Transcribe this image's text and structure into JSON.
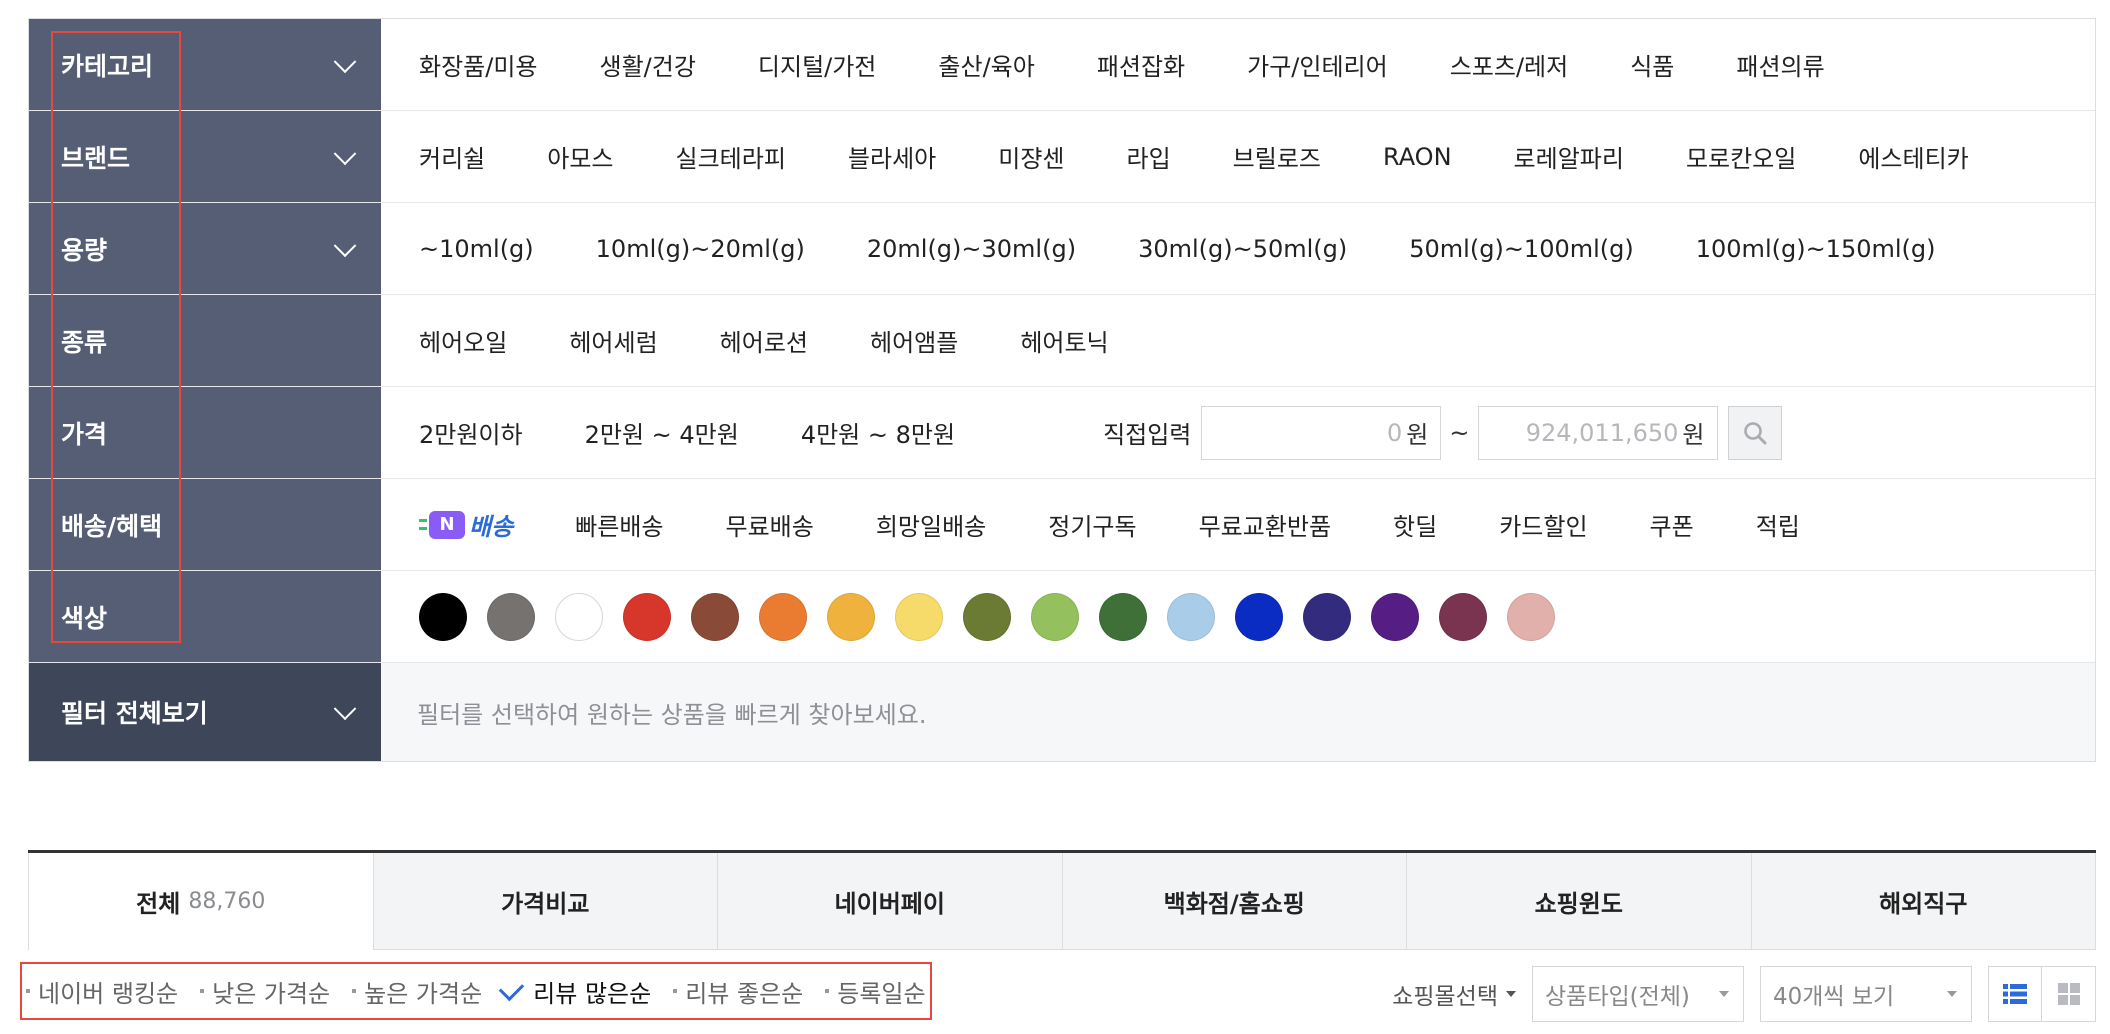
{
  "filter": {
    "rows": [
      {
        "label": "카테고리",
        "expandable": true,
        "options": [
          "화장품/미용",
          "생활/건강",
          "디지털/가전",
          "출산/육아",
          "패션잡화",
          "가구/인테리어",
          "스포츠/레저",
          "식품",
          "패션의류"
        ]
      },
      {
        "label": "브랜드",
        "expandable": true,
        "options": [
          "커리쉴",
          "아모스",
          "실크테라피",
          "블라세아",
          "미쟝센",
          "라입",
          "브릴로즈",
          "RAON",
          "로레알파리",
          "모로칸오일",
          "에스테티카"
        ]
      },
      {
        "label": "용량",
        "expandable": true,
        "options": [
          "~10ml(g)",
          "10ml(g)~20ml(g)",
          "20ml(g)~30ml(g)",
          "30ml(g)~50ml(g)",
          "50ml(g)~100ml(g)",
          "100ml(g)~150ml(g)"
        ]
      },
      {
        "label": "종류",
        "expandable": false,
        "options": [
          "헤어오일",
          "헤어세럼",
          "헤어로션",
          "헤어앰플",
          "헤어토닉"
        ]
      },
      {
        "label": "가격",
        "expandable": false,
        "options": [
          "2만원이하",
          "2만원 ~ 4만원",
          "4만원 ~ 8만원"
        ],
        "direct_input_label": "직접입력",
        "min_placeholder": "0",
        "max_placeholder": "924,011,650",
        "currency": "원",
        "range_sep": "~"
      },
      {
        "label": "배송/혜택",
        "expandable": false,
        "npay_badge": "N",
        "npay_text": "배송",
        "options": [
          "빠른배송",
          "무료배송",
          "희망일배송",
          "정기구독",
          "무료교환반품",
          "핫딜",
          "카드할인",
          "쿠폰",
          "적립"
        ]
      },
      {
        "label": "색상",
        "expandable": false,
        "colors": [
          "#000000",
          "#757270",
          "#ffffff",
          "#d7362b",
          "#8a4a38",
          "#ea7c32",
          "#efb23c",
          "#f6db6a",
          "#6b7b33",
          "#95c05e",
          "#3e7038",
          "#a9cde9",
          "#0b2cc2",
          "#332b7e",
          "#561d85",
          "#7a3450",
          "#e1b0ab"
        ]
      }
    ],
    "view_all": {
      "label": "필터 전체보기",
      "hint": "필터를 선택하여 원하는 상품을 빠르게 찾아보세요."
    }
  },
  "tabs": [
    {
      "label": "전체",
      "count": "88,760",
      "active": true
    },
    {
      "label": "가격비교"
    },
    {
      "label": "네이버페이"
    },
    {
      "label": "백화점/홈쇼핑"
    },
    {
      "label": "쇼핑윈도"
    },
    {
      "label": "해외직구"
    }
  ],
  "sort": {
    "options": [
      {
        "label": "네이버 랭킹순",
        "checked": false
      },
      {
        "label": "낮은 가격순",
        "checked": false
      },
      {
        "label": "높은 가격순",
        "checked": false
      },
      {
        "label": "리뷰 많은순",
        "checked": true
      },
      {
        "label": "리뷰 좋은순",
        "checked": false
      },
      {
        "label": "등록일순",
        "checked": false
      }
    ]
  },
  "tools": {
    "mall_select": "쇼핑몰선택",
    "product_type": "상품타입(전체)",
    "per_page": "40개씩 보기",
    "list_view_icon": "list-view-icon",
    "grid_view_icon": "grid-view-icon"
  },
  "colors": {
    "label_bg": "#555e74",
    "label_bg_dark": "#3e4659",
    "highlight": "#e8473b",
    "accent_blue": "#2b6ad8"
  }
}
